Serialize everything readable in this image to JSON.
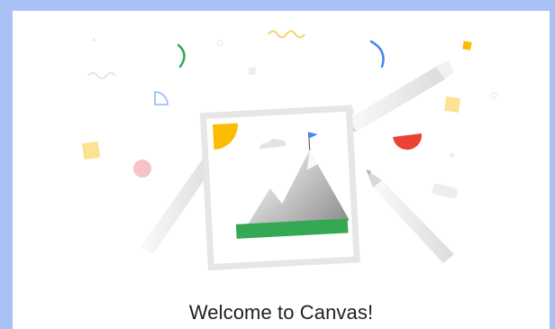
{
  "welcome": {
    "title": "Welcome to Canvas!"
  },
  "illustration": {
    "name": "canvas-welcome-illustration",
    "colors": {
      "green": "#34a853",
      "blue": "#4285f4",
      "yellow": "#fbbc04",
      "red": "#ea4335",
      "frame": "#c9c9c9",
      "frame_border": "#e8e8e8"
    }
  },
  "colors": {
    "window_frame": "#a9c2f6",
    "text": "#202124",
    "background": "#ffffff"
  }
}
